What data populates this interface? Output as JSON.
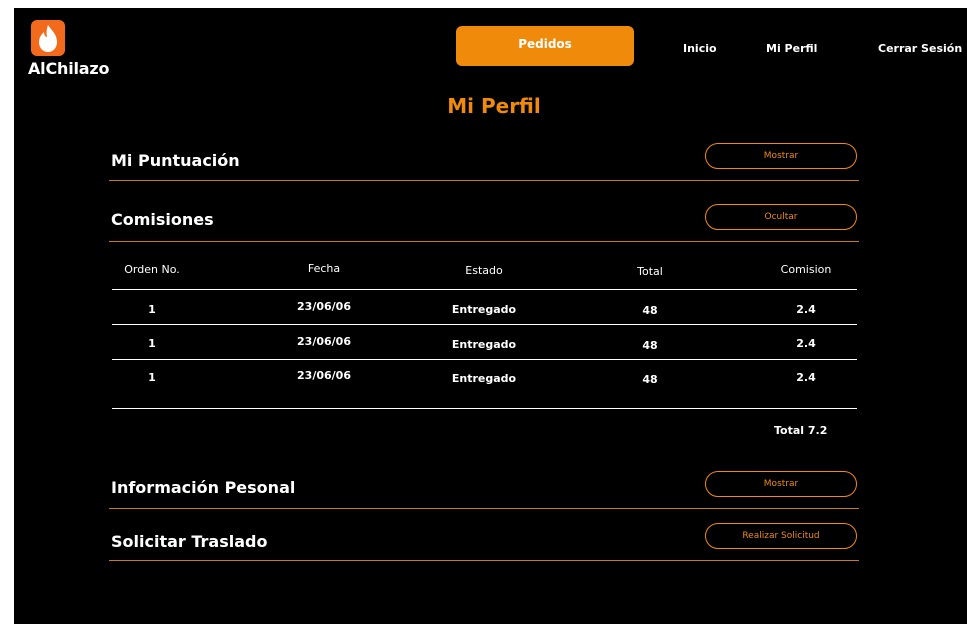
{
  "app": {
    "brand": "AlChilazo"
  },
  "nav": {
    "primary_label": "Pedidos",
    "links": [
      "Inicio",
      "Mi Perfil",
      "Cerrar Sesión"
    ]
  },
  "page": {
    "title": "Mi Perfil"
  },
  "sections": {
    "puntuacion": {
      "title": "Mi Puntuación",
      "button": "Mostrar"
    },
    "comisiones": {
      "title": "Comisiones",
      "button": "Ocultar"
    },
    "info": {
      "title": "Información Pesonal",
      "button": "Mostrar"
    },
    "traslado": {
      "title": "Solicitar Traslado",
      "button": "Realizar Solicitud"
    }
  },
  "table": {
    "headers": [
      "Orden No.",
      "Fecha",
      "Estado",
      "Total",
      "Comision"
    ],
    "rows": [
      {
        "orden": "1",
        "fecha": "23/06/06",
        "estado": "Entregado",
        "total": "48",
        "comision": "2.4"
      },
      {
        "orden": "1",
        "fecha": "23/06/06",
        "estado": "Entregado",
        "total": "48",
        "comision": "2.4"
      },
      {
        "orden": "1",
        "fecha": "23/06/06",
        "estado": "Entregado",
        "total": "48",
        "comision": "2.4"
      }
    ],
    "total_label": "Total 7.2"
  },
  "colors": {
    "accent": "#f08a0a",
    "background": "#000000",
    "text": "#ffffff"
  },
  "icons": {
    "logo": "flame-icon"
  }
}
